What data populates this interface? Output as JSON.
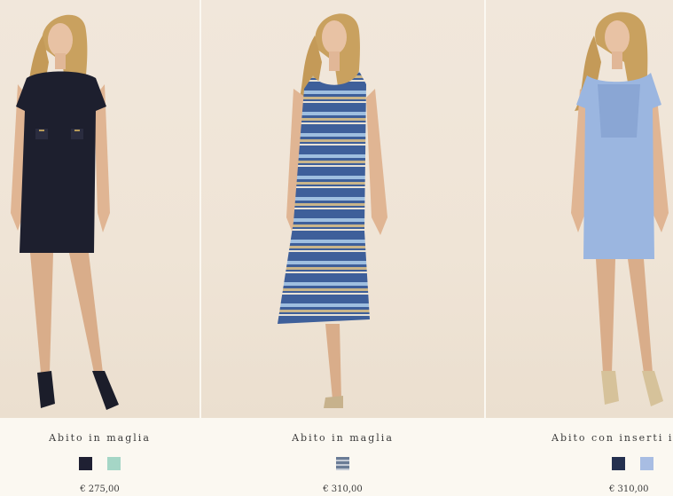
{
  "products": [
    {
      "name": "Abito in maglia",
      "price": "€ 275,00",
      "swatches": [
        {
          "label": "navy",
          "color": "#1f2033"
        },
        {
          "label": "mint",
          "color": "#a5d6c6"
        }
      ]
    },
    {
      "name": "Abito in maglia",
      "price": "€ 310,00",
      "swatches": [
        {
          "label": "blue stripe",
          "color": "#8a98ad"
        }
      ]
    },
    {
      "name": "Abito con inserti in pizzo",
      "price": "€ 310,00",
      "swatches": [
        {
          "label": "navy",
          "color": "#24304f"
        },
        {
          "label": "light blue",
          "color": "#a8bde3"
        }
      ]
    }
  ],
  "colors": {
    "background": "#fbf8f1",
    "photo_bg": "#efe4d6",
    "navy_dress": "#1d1f2e",
    "blue_dress": "#9bb6e0",
    "stripe_blue": "#3e5f9a"
  }
}
